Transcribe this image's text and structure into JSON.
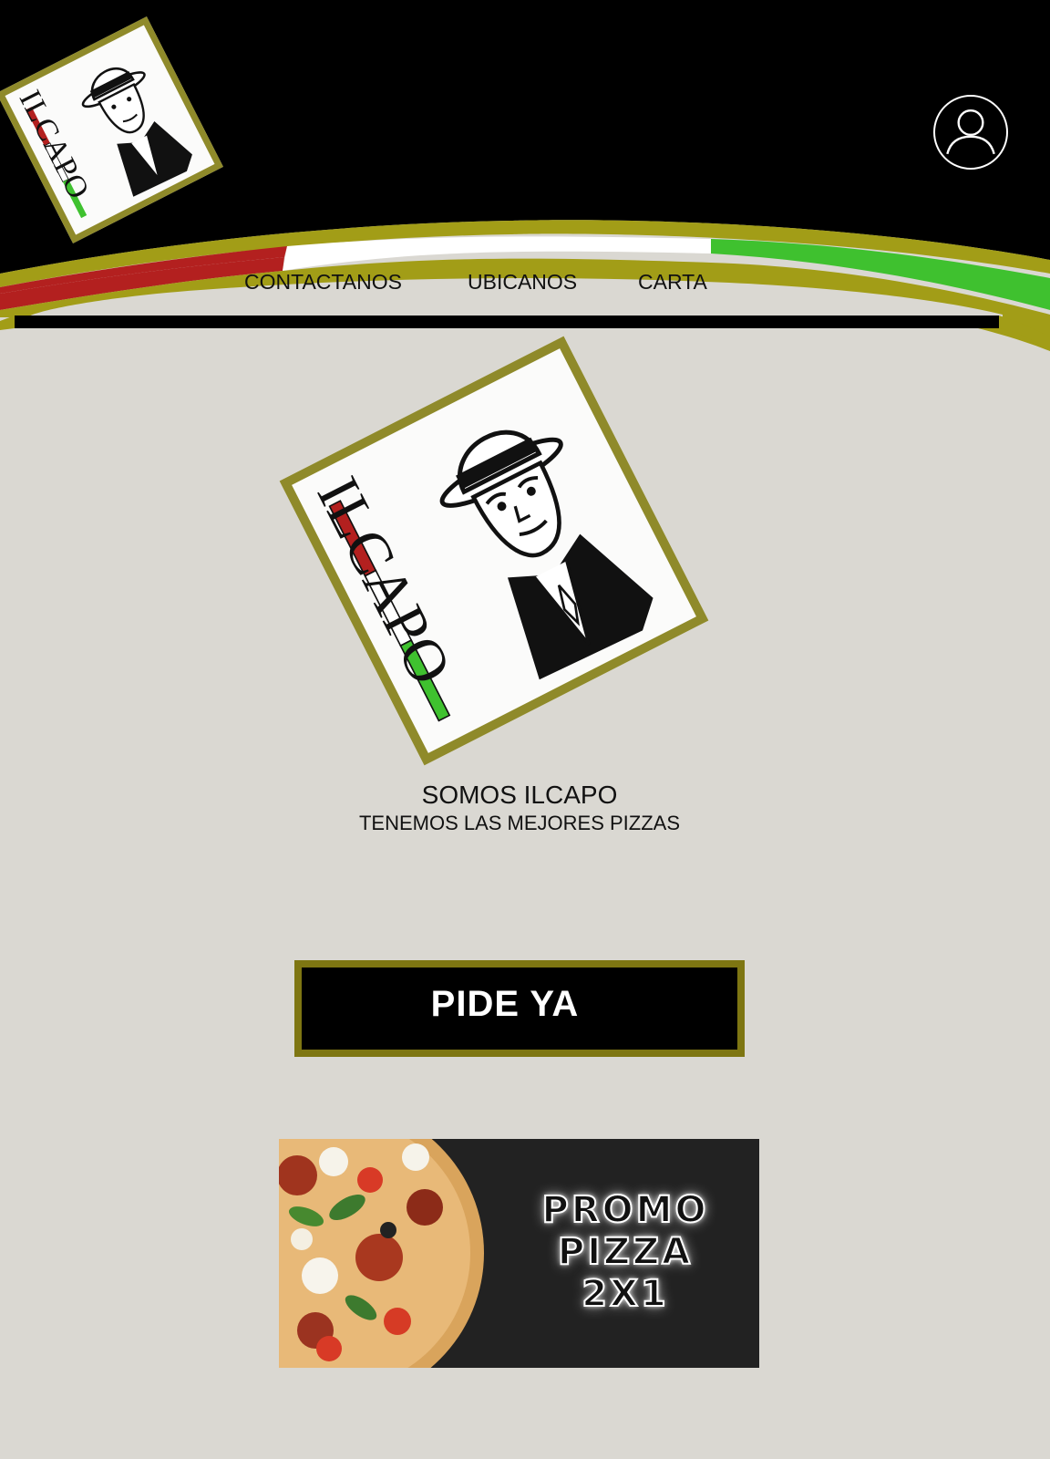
{
  "brand": {
    "logo_text": "ILCAPO"
  },
  "nav": {
    "items": [
      {
        "label": "CONTACTANOS"
      },
      {
        "label": "UBICANOS"
      },
      {
        "label": "CARTA"
      }
    ]
  },
  "user": {
    "icon": "user-icon"
  },
  "hero": {
    "title": "SOMOS ILCAPO",
    "subtitle": "TENEMOS LAS MEJORES PIZZAS"
  },
  "cta": {
    "label": "PIDE YA"
  },
  "promo": {
    "lines": [
      "PROMO",
      "PIZZA",
      "2X1"
    ]
  },
  "colors": {
    "background": "#dad8d2",
    "header": "#000000",
    "gold": "#8f8a2a",
    "red": "#b3201f",
    "green": "#3fc12f"
  }
}
